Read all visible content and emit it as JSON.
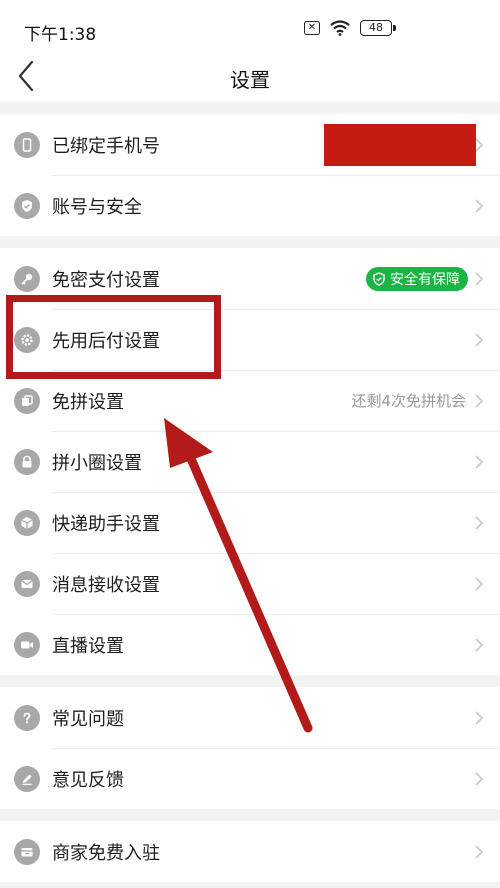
{
  "status_bar": {
    "time": "下午1:38",
    "battery": "48"
  },
  "nav": {
    "title": "设置"
  },
  "groups": [
    {
      "items": [
        {
          "label": "已绑定手机号"
        },
        {
          "label": "账号与安全"
        }
      ]
    },
    {
      "items": [
        {
          "label": "免密支付设置",
          "badge": "安全有保障"
        },
        {
          "label": "先用后付设置"
        },
        {
          "label": "免拼设置",
          "right_text": "还剩4次免拼机会"
        },
        {
          "label": "拼小圈设置"
        },
        {
          "label": "快递助手设置"
        },
        {
          "label": "消息接收设置"
        },
        {
          "label": "直播设置"
        }
      ]
    },
    {
      "items": [
        {
          "label": "常见问题"
        },
        {
          "label": "意见反馈"
        }
      ]
    },
    {
      "items": [
        {
          "label": "商家免费入驻"
        }
      ]
    }
  ],
  "colors": {
    "badge_green": "#1bb546",
    "annotation_red": "#b31b1b",
    "icon_gray": "#a8a8a8"
  },
  "icons": [
    "phone-icon",
    "shield-icon",
    "key-icon",
    "gear-icon",
    "dice-icon",
    "lock-icon",
    "package-icon",
    "mail-icon",
    "video-icon",
    "question-icon",
    "pen-icon",
    "store-icon"
  ]
}
